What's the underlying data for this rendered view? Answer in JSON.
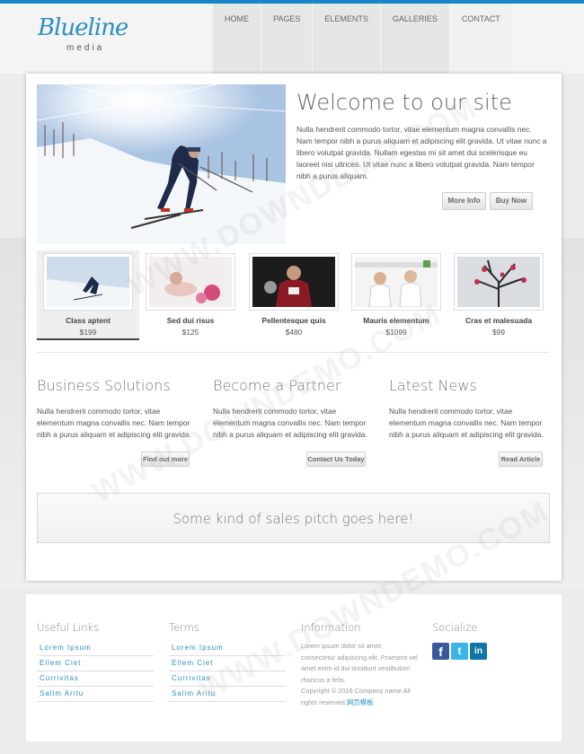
{
  "brand": {
    "name": "Blueline",
    "tagline": "media",
    "accent": "#1a86c8"
  },
  "nav": [
    "HOME",
    "PAGES",
    "ELEMENTS",
    "GALLERIES",
    "CONTACT"
  ],
  "hero": {
    "title": "Welcome to our site",
    "text": "Nulla hendrerit commodo tortor, vitae elementum magna convallis nec. Nam tempor nibh a purus aliquam et adipiscing elit gravida. Ut vitae nunc a libero volutpat gravida. Nullam egestas mi sit amet dui scelerisque eu laoreet nisi ultrices. Ut vitae nunc a libero volutpat gravida. Nam tempor nibh a purus aliquam.",
    "more_info": "More Info",
    "buy_now": "Buy Now"
  },
  "products": [
    {
      "title": "Class aptent",
      "price": "$199",
      "active": true
    },
    {
      "title": "Sed dui risus",
      "price": "$125"
    },
    {
      "title": "Pellentesque quis",
      "price": "$480"
    },
    {
      "title": "Mauris elementum",
      "price": "$1099"
    },
    {
      "title": "Cras et malesuada",
      "price": "$99"
    }
  ],
  "columns": [
    {
      "title": "Business Solutions",
      "text": "Nulla hendrerit commodo tortor, vitae elementum magna convallis nec. Nam tempor nibh a purus aliquam et adipiscing elit gravida.",
      "button": "Find out more"
    },
    {
      "title": "Become a Partner",
      "text": "Nulla hendrerit commodo tortor, vitae elementum magna convallis nec. Nam tempor nibh a purus aliquam et adipiscing elit gravida.",
      "button": "Contact Us Today"
    },
    {
      "title": "Latest News",
      "text": "Nulla hendrerit commodo tortor, vitae elementum magna convallis nec. Nam tempor nibh a purus aliquam et adipiscing elit gravida.",
      "button": "Read Article"
    }
  ],
  "pitch": "Some kind of sales pitch goes here!",
  "footer": {
    "useful_links_title": "Useful Links",
    "useful_links": [
      "Lorem Ipsum",
      "Ellem Ciet",
      "Currivitas",
      "Salim Aritu"
    ],
    "terms_title": "Terms",
    "terms": [
      "Lorem Ipsum",
      "Ellem Ciet",
      "Currivitas",
      "Salim Aritu"
    ],
    "information_title": "Information",
    "information_text": "Lorem ipsum dolor sit amet, consectetur adipiscing elit. Praesent vel amet enim id dui tincidunt vestibulum rhoncus a felis.",
    "copyright": "Copyright © 2016 Company name All rights reserved.",
    "copyright_link": "网页模板",
    "socialize_title": "Socialize",
    "social_icons": [
      "facebook-icon",
      "twitter-icon",
      "linkedin-icon"
    ]
  },
  "watermark": "WWW.DOWNDEMO.COM"
}
